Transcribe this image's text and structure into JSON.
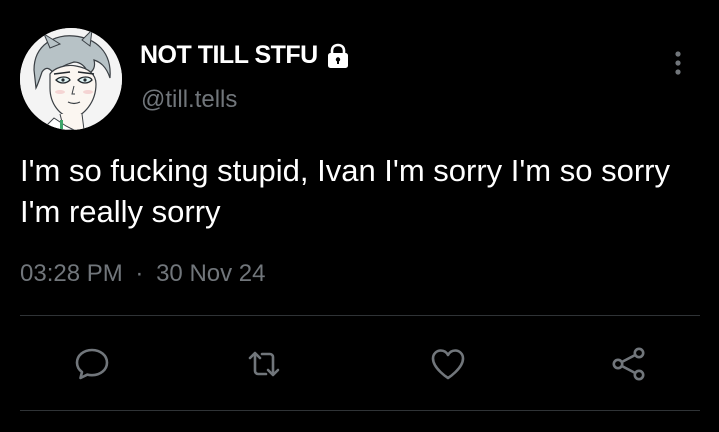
{
  "profile": {
    "display_name": "NOT TILL STFU",
    "handle": "@till.tells",
    "avatar_icon": "avatar-anime-portrait",
    "protected_icon": "lock-icon"
  },
  "tweet": {
    "text": "I'm so fucking stupid, Ivan I'm sorry I'm so sorry I'm really sorry",
    "time": "03:28 PM",
    "separator": "·",
    "date": "30 Nov 24"
  },
  "actions": [
    {
      "name": "reply",
      "icon": "speech-bubble-icon"
    },
    {
      "name": "retweet",
      "icon": "retweet-icon"
    },
    {
      "name": "like",
      "icon": "heart-icon"
    },
    {
      "name": "share",
      "icon": "share-icon"
    }
  ],
  "menu": {
    "icon": "more-options-icon"
  },
  "colors": {
    "background": "#000000",
    "primary_text": "#ffffff",
    "secondary_text": "#71767b",
    "icon": "#71767b",
    "divider": "#2f3336"
  }
}
